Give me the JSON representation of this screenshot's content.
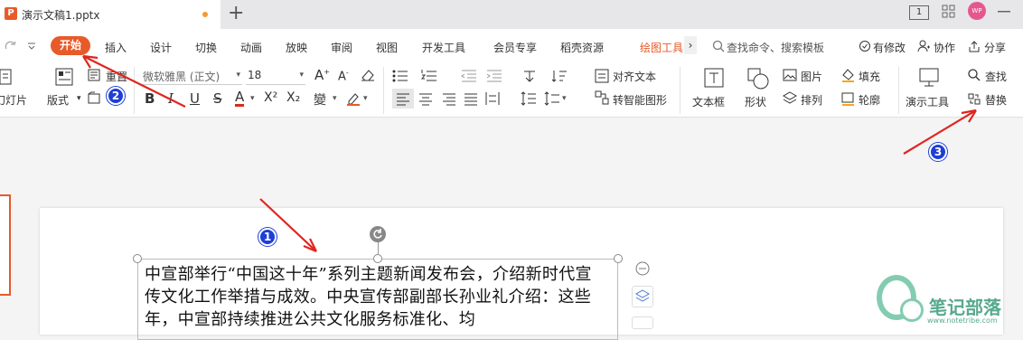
{
  "tab": {
    "title": "演示文稿1.pptx",
    "add": "+"
  },
  "titlebar": {
    "layout_badge": "1",
    "avatar": "WP"
  },
  "menu": {
    "items": [
      "开始",
      "插入",
      "设计",
      "切换",
      "动画",
      "放映",
      "审阅",
      "视图",
      "开发工具",
      "会员专享",
      "稻壳资源"
    ],
    "drawing_tools": "绘图工具",
    "search": "查找命令、搜索模板",
    "changes": "有修改",
    "collab": "协作",
    "share": "分享"
  },
  "ribbon": {
    "new_slide": "新建幻灯片",
    "layout": "版式",
    "reset": "重置",
    "section": "节",
    "font_name": "微软雅黑 (正文)",
    "font_size": "18",
    "format": {
      "bold": "B",
      "italic": "I",
      "underline": "U",
      "strike": "S",
      "color": "A",
      "sup": "X²",
      "sub": "X₂"
    },
    "align_text": "对齐文本",
    "smart_graphic": "转智能图形",
    "textbox": "文本框",
    "shape": "形状",
    "picture": "图片",
    "arrange": "排列",
    "fill": "填充",
    "outline": "轮廓",
    "presentation_tools": "演示工具",
    "find": "查找",
    "replace": "替换"
  },
  "slide": {
    "text": "中宣部举行“中国这十年”系列主题新闻发布会，介绍新时代宣传文化工作举措与成效。中央宣传部副部长孙业礼介绍：这些年，中宣部持续推进公共文化服务标准化、均"
  },
  "annotations": {
    "n1": "1",
    "n2": "2",
    "n3": "3"
  },
  "watermark": {
    "name": "笔记部落",
    "url": "www.notetribe.com"
  },
  "colors": {
    "accent": "#e85a29",
    "arrow": "#e0261f",
    "badge": "#1e3ed6"
  }
}
